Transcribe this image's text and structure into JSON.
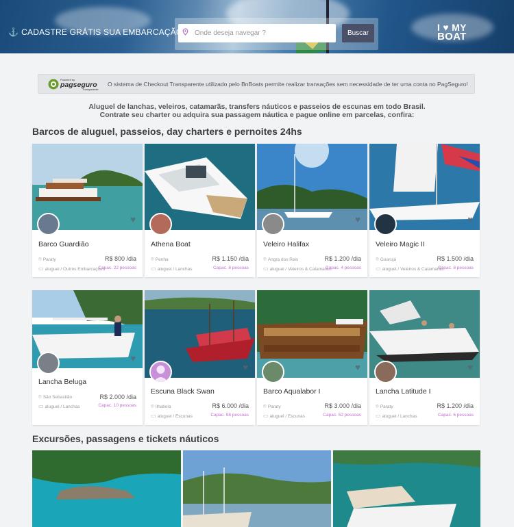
{
  "header": {
    "register_label": "CADASTRE GRÁTIS SUA EMBARCAÇÃO!",
    "search_placeholder": "Onde deseja navegar ?",
    "search_button": "Buscar",
    "logo_line1": "I ♥ MY",
    "logo_line2": "BOAT"
  },
  "pagseguro": {
    "logo_powered": "Powered by",
    "logo_brand": "pagseguro",
    "logo_sub": "Transparente",
    "text": "O sistema de Checkout Transparente utilizado pelo BnBoats permite realizar transações sem necessidade de ter uma conta no PagSeguro!"
  },
  "intro": {
    "line1": "Aluguel de lanchas, veleiros, catamarãs, transfers náuticos e passeios de escunas em todo Brasil.",
    "line2": "Contrate seu charter ou adquira sua passagem náutica e pague online em parcelas, confira:"
  },
  "sections": {
    "charters_title": "Barcos de aluguel, passeios, day charters e pernoites 24hs",
    "excursions_title": "Excursões, passagens e tickets náuticos"
  },
  "cards": [
    {
      "name": "Barco Guardião",
      "location": "Paraty",
      "category": "aluguel / Outros Embarcações",
      "price": "R$ 800 /dia",
      "capacity": "Capac. 22 pessoas"
    },
    {
      "name": "Athena Boat",
      "location": "Penha",
      "category": "aluguel / Lanchas",
      "price": "R$ 1.150 /dia",
      "capacity": "Capac. 8 pessoas"
    },
    {
      "name": "Veleiro Halifax",
      "location": "Angra dos Reis",
      "category": "aluguel / Veleiros & Catamarãs",
      "price": "R$ 1.200 /dia",
      "capacity": "Capac. 4 pessoas"
    },
    {
      "name": "Veleiro Magic II",
      "location": "Guarujá",
      "category": "aluguel / Veleiros & Catamarãs",
      "price": "R$ 1.500 /dia",
      "capacity": "Capac. 8 pessoas"
    },
    {
      "name": "Lancha Beluga",
      "location": "São Sebastião",
      "category": "aluguel / Lanchas",
      "price": "R$ 2.000 /dia",
      "capacity": "Capac. 10 pessoas"
    },
    {
      "name": "Escuna Black Swan",
      "location": "Ilhabela",
      "category": "aluguel / Escunas",
      "price": "R$ 6.000 /dia",
      "capacity": "Capac. 98 pessoas"
    },
    {
      "name": "Barco Aqualabor I",
      "location": "Paraty",
      "category": "aluguel / Escunas",
      "price": "R$ 3.000 /dia",
      "capacity": "Capac. 52 pessoas"
    },
    {
      "name": "Lancha Latitude I",
      "location": "Paraty",
      "category": "aluguel / Lanchas",
      "price": "R$ 1.200 /dia",
      "capacity": "Capac. 6 pessoas"
    }
  ],
  "icons": {
    "anchor": "anchor-icon",
    "pin": "map-pin-icon",
    "folder": "folder-icon",
    "heart": "heart-icon"
  },
  "colors": {
    "accent": "#c070d0",
    "button": "#4a5068",
    "background": "#f2f3f5"
  }
}
